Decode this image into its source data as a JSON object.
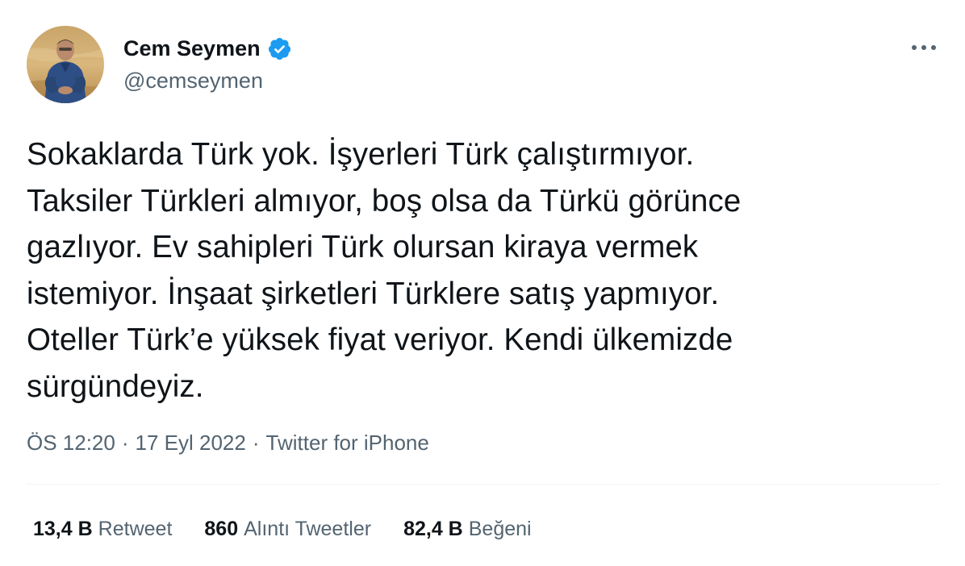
{
  "author": {
    "display_name": "Cem Seymen",
    "handle": "@cemseymen",
    "verified_badge": "verified-badge-icon",
    "avatar_alt": "avatar-photo"
  },
  "menu": {
    "more_icon": "more-horizontal-icon"
  },
  "tweet": {
    "text": "Sokaklarda Türk yok. İşyerleri Türk çalıştırmıyor.\nTaksiler Türkleri almıyor, boş  olsa da Türkü görünce\ngazlıyor. Ev sahipleri Türk olursan kiraya vermek\nistemiyor. İnşaat şirketleri Türklere satış yapmıyor.\nOteller Türk’e yüksek fiyat veriyor. Kendi ülkemizde\nsürgündeyiz."
  },
  "meta": {
    "time": "ÖS 12:20",
    "separator": "·",
    "date": "17 Eyl 2022",
    "source": "Twitter for iPhone"
  },
  "stats": [
    {
      "count": "13,4 B",
      "label": "Retweet"
    },
    {
      "count": "860",
      "label": "Alıntı Tweetler"
    },
    {
      "count": "82,4 B",
      "label": "Beğeni"
    }
  ],
  "colors": {
    "text_primary": "#0f1419",
    "text_secondary": "#536471",
    "verified_blue": "#1d9bf0",
    "divider": "#eff3f4"
  }
}
